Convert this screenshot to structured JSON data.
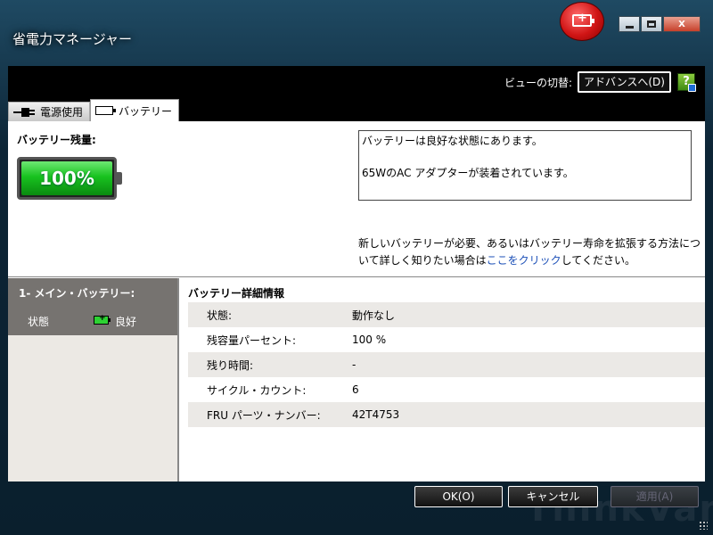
{
  "window": {
    "title": "省電力マネージャー",
    "controls": {
      "minimize": "",
      "maximize": "",
      "close": "X"
    }
  },
  "header": {
    "view_switch_label": "ビューの切替:",
    "advanced_button": "アドバンスへ(D)",
    "help_icon": "?"
  },
  "tabs": [
    {
      "label": "電源使用",
      "icon": "plug-icon",
      "active": false
    },
    {
      "label": "バッテリー",
      "icon": "battery-icon",
      "active": true
    }
  ],
  "battery": {
    "remaining_label": "バッテリー残量:",
    "percent_text": "100%",
    "level": 1.0,
    "status_line1": "バッテリーは良好な状態にあります。",
    "status_line2": "65WのAC アダプターが装着されています。",
    "advice_before": "新しいバッテリーが必要、あるいはバッテリー寿命を拡張する方法について詳しく知りたい場合は",
    "advice_link": "ここをクリック",
    "advice_after": "してください。"
  },
  "left_panel": {
    "title": "1- メイン・バッテリー:",
    "state_label": "状態",
    "state_value": "良好"
  },
  "details": {
    "title": "バッテリー詳細情報",
    "rows": [
      {
        "key": "状態:",
        "value": "動作なし"
      },
      {
        "key": "残容量パーセント:",
        "value": "100 %"
      },
      {
        "key": "残り時間:",
        "value": "-"
      },
      {
        "key": "サイクル・カウント:",
        "value": "6"
      },
      {
        "key": "FRU パーツ・ナンバー:",
        "value": "42T4753"
      }
    ]
  },
  "buttons": {
    "ok": "OK(O)",
    "cancel": "キャンセル",
    "apply": "適用(A)"
  },
  "colors": {
    "battery_green": "#18c21f",
    "link_blue": "#1b4fb7",
    "close_red": "#c7402a"
  }
}
